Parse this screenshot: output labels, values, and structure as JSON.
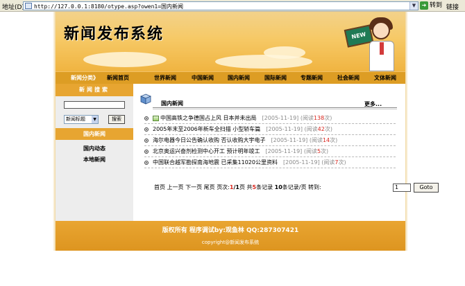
{
  "browser": {
    "address_label": "地址(D)",
    "url": "http://127.0.0.1:8180/otype.asp?owen1=国内新闻",
    "go_label": "转到",
    "links_label": "链接"
  },
  "banner": {
    "title": "新闻发布系统",
    "board_text": "NEW"
  },
  "nav": {
    "category_label": "新闻分类》",
    "items": [
      "新闻首页",
      "世界新闻",
      "中国新闻",
      "国内新闻",
      "国际新闻",
      "专题新闻",
      "社会新闻",
      "文体新闻"
    ]
  },
  "sidebar": {
    "search_title": "新闻搜索",
    "search_input_value": "",
    "search_select_value": "新闻标题",
    "search_button": "搜索",
    "section_title": "国内新闻",
    "links": [
      "国内动态",
      "本地新闻"
    ]
  },
  "content": {
    "title": "国内新闻",
    "more": "更多...",
    "news": [
      {
        "title": "中国高铁之争德国占上风 日本并未出局",
        "date": "[2005-11-19]",
        "hits_prefix": "(阅读",
        "hits": "138",
        "hits_suffix": "次)",
        "has_image": true
      },
      {
        "title": "2005年末至2006年新车全扫描 小型轿车篇",
        "date": "[2005-11-19]",
        "hits_prefix": "(阅读",
        "hits": "42",
        "hits_suffix": "次)",
        "has_image": false
      },
      {
        "title": "海尔电器今日公告确认收购 否认收购大宇电子",
        "date": "[2005-11-19]",
        "hits_prefix": "(阅读",
        "hits": "14",
        "hits_suffix": "次)",
        "has_image": false
      },
      {
        "title": "北京奥运兴奋剂检测中心开工 预计明年竣工",
        "date": "[2005-11-19]",
        "hits_prefix": "(阅读",
        "hits": "5",
        "hits_suffix": "次)",
        "has_image": false
      },
      {
        "title": "中国联合越军勘探南海地震 已采集11020公里资料",
        "date": "[2005-11-19]",
        "hits_prefix": "(阅读",
        "hits": "7",
        "hits_suffix": "次)",
        "has_image": false
      }
    ]
  },
  "pager": {
    "first": "首页",
    "prev": "上一页",
    "next": "下一页",
    "last": "尾页",
    "page_label": "页次:",
    "current": "1",
    "total": "/1",
    "page_unit": "页",
    "total_prefix": "共",
    "total_records": "5",
    "total_suffix": "条记录",
    "per_page": "10",
    "per_page_suffix": "条记录/页",
    "goto_label": "转到:",
    "goto_value": "1",
    "go_button": "Goto"
  },
  "footer": {
    "line1": "版权所有 程序调试by:观鱼林 QQ:287307421",
    "line2": "copyright@新闻发布系统"
  },
  "colors": {
    "nav": "#dd9d24",
    "sidebar_head": "#e7a531",
    "footer": "#e9a531",
    "hit_red": "#d8241c"
  }
}
